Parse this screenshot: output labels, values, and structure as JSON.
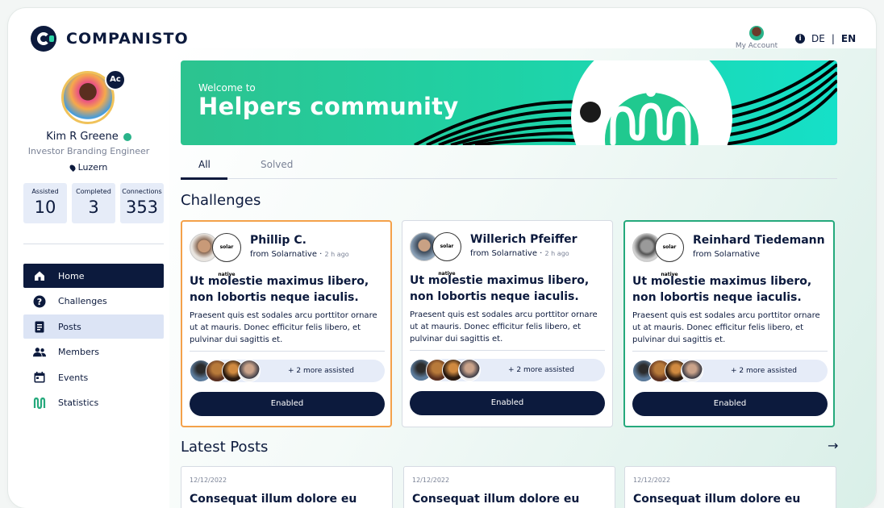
{
  "header": {
    "brand": "COMPANISTO",
    "account_label": "My Account",
    "lang_de": "DE",
    "lang_sep": "|",
    "lang_en": "EN"
  },
  "profile": {
    "name": "Kim R Greene",
    "role": "Investor Branding Engineer",
    "location": "Luzern",
    "badge": "Ac",
    "stats": [
      {
        "label": "Assisted",
        "value": "10"
      },
      {
        "label": "Completed",
        "value": "3"
      },
      {
        "label": "Connections",
        "value": "353"
      }
    ]
  },
  "nav": {
    "items": [
      {
        "label": "Home",
        "icon": "home-icon"
      },
      {
        "label": "Challenges",
        "icon": "question-icon"
      },
      {
        "label": "Posts",
        "icon": "document-icon"
      },
      {
        "label": "Members",
        "icon": "members-icon"
      },
      {
        "label": "Events",
        "icon": "calendar-icon"
      },
      {
        "label": "Statistics",
        "icon": "statistics-icon"
      }
    ]
  },
  "banner": {
    "welcome": "Welcome to",
    "title": "Helpers community"
  },
  "tabs": [
    "All",
    "Solved"
  ],
  "sections": {
    "challenges": "Challenges",
    "latest_posts": "Latest Posts"
  },
  "cards": [
    {
      "name": "Phillip C.",
      "from": "from Solarnative",
      "ago": "2 h ago",
      "org_logo": "solar native",
      "title": "Ut molestie maximus libero, non lobortis neque iaculis.",
      "body": "Praesent quis est sodales arcu porttitor ornare ut at mauris. Donec efficitur felis libero, et pulvinar dui sagittis et.",
      "more": "+ 2 more assisted",
      "button": "Enabled",
      "accent": "#f4a14a"
    },
    {
      "name": "Willerich Pfeiffer",
      "from": "from Solarnative",
      "ago": "2 h ago",
      "org_logo": "solar native",
      "title": "Ut molestie maximus libero, non lobortis neque iaculis.",
      "body": "Praesent quis est sodales arcu porttitor ornare ut at mauris. Donec efficitur felis libero, et pulvinar dui sagittis et.",
      "more": "+ 2 more assisted",
      "button": "Enabled",
      "accent": "#d6dbe3"
    },
    {
      "name": "Reinhard Tiedemann",
      "from": "from Solarnative",
      "ago": "",
      "org_logo": "solar native",
      "title": "Ut molestie maximus libero, non lobortis neque iaculis.",
      "body": "Praesent quis est sodales arcu porttitor ornare ut at mauris. Donec efficitur felis libero, et pulvinar dui sagittis et.",
      "more": "+ 2 more assisted",
      "button": "Enabled",
      "accent": "#25a97c"
    }
  ],
  "posts": [
    {
      "date": "12/12/2022",
      "title": "Consequat illum dolore eu"
    },
    {
      "date": "12/12/2022",
      "title": "Consequat illum dolore eu"
    },
    {
      "date": "12/12/2022",
      "title": "Consequat illum dolore eu"
    }
  ],
  "colors": {
    "navy": "#0c1a3d",
    "green": "#25a97c",
    "orange": "#f4a14a",
    "pill": "#e6ecf8"
  }
}
